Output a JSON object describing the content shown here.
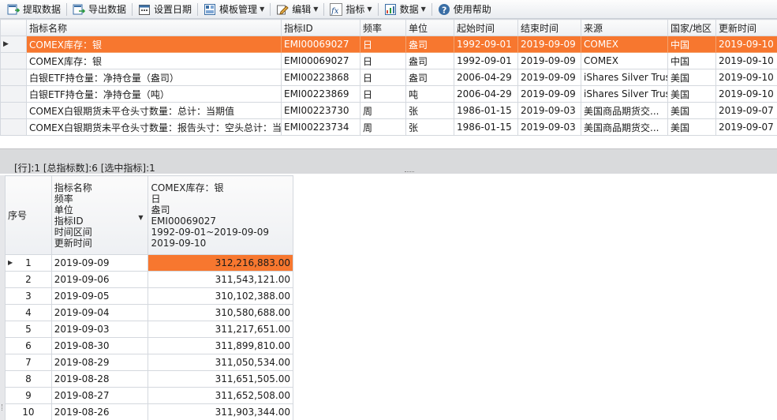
{
  "toolbar": {
    "buttons": [
      {
        "label": "提取数据",
        "icon": "extract-data-icon"
      },
      {
        "label": "导出数据",
        "icon": "export-data-icon"
      },
      {
        "label": "设置日期",
        "icon": "calendar-icon"
      },
      {
        "label": "模板管理",
        "icon": "template-icon",
        "dropdown": true
      },
      {
        "label": "编辑",
        "icon": "edit-icon",
        "dropdown": true
      },
      {
        "label": "指标",
        "icon": "fx-icon",
        "dropdown": true
      },
      {
        "label": "数据",
        "icon": "data-icon",
        "dropdown": true
      },
      {
        "label": "使用帮助",
        "icon": "help-icon"
      }
    ]
  },
  "indicator_table": {
    "columns": [
      "指标名称",
      "指标ID",
      "频率",
      "单位",
      "起始时间",
      "结束时间",
      "来源",
      "国家/地区",
      "更新时间"
    ],
    "rows": [
      [
        "COMEX库存：银",
        "EMI00069027",
        "日",
        "盎司",
        "1992-09-01",
        "2019-09-09",
        "COMEX",
        "中国",
        "2019-09-10"
      ],
      [
        "COMEX库存：银",
        "EMI00069027",
        "日",
        "盎司",
        "1992-09-01",
        "2019-09-09",
        "COMEX",
        "中国",
        "2019-09-10"
      ],
      [
        "白银ETF持仓量：净持仓量（盎司）",
        "EMI00223868",
        "日",
        "盎司",
        "2006-04-29",
        "2019-09-09",
        "iShares Silver Trust",
        "美国",
        "2019-09-10"
      ],
      [
        "白银ETF持仓量：净持仓量（吨）",
        "EMI00223869",
        "日",
        "吨",
        "2006-04-29",
        "2019-09-09",
        "iShares Silver Trust",
        "美国",
        "2019-09-10"
      ],
      [
        "COMEX白银期货未平仓头寸数量：总计：当期值",
        "EMI00223730",
        "周",
        "张",
        "1986-01-15",
        "2019-09-03",
        "美国商品期货交...",
        "美国",
        "2019-09-07"
      ],
      [
        "COMEX白银期货未平仓头寸数量：报告头寸：空头总计：当",
        "EMI00223734",
        "周",
        "张",
        "1986-01-15",
        "2019-09-03",
        "美国商品期货交...",
        "美国",
        "2019-09-07"
      ]
    ],
    "selected_row": 0
  },
  "status": "[行]:1 [总指标数]:6 [选中指标]:1",
  "data_table": {
    "seq_header": "序号",
    "meta_labels": [
      "指标名称",
      "频率",
      "单位",
      "指标ID",
      "时间区间",
      "更新时间"
    ],
    "series_meta": [
      "COMEX库存：银",
      "日",
      "盎司",
      "EMI00069027",
      "1992-09-01~2019-09-09",
      "2019-09-10"
    ],
    "rows": [
      {
        "seq": "1",
        "date": "2019-09-09",
        "value": "312,216,883.00"
      },
      {
        "seq": "2",
        "date": "2019-09-06",
        "value": "311,543,121.00"
      },
      {
        "seq": "3",
        "date": "2019-09-05",
        "value": "310,102,388.00"
      },
      {
        "seq": "4",
        "date": "2019-09-04",
        "value": "310,580,688.00"
      },
      {
        "seq": "5",
        "date": "2019-09-03",
        "value": "311,217,651.00"
      },
      {
        "seq": "6",
        "date": "2019-08-30",
        "value": "311,899,810.00"
      },
      {
        "seq": "7",
        "date": "2019-08-29",
        "value": "311,050,534.00"
      },
      {
        "seq": "8",
        "date": "2019-08-28",
        "value": "311,651,505.00"
      },
      {
        "seq": "9",
        "date": "2019-08-27",
        "value": "311,652,508.00"
      },
      {
        "seq": "10",
        "date": "2019-08-26",
        "value": "311,903,344.00"
      }
    ],
    "selected_row": 0
  },
  "colors": {
    "selection": "#f7772f",
    "series_header": "#f0782a"
  }
}
